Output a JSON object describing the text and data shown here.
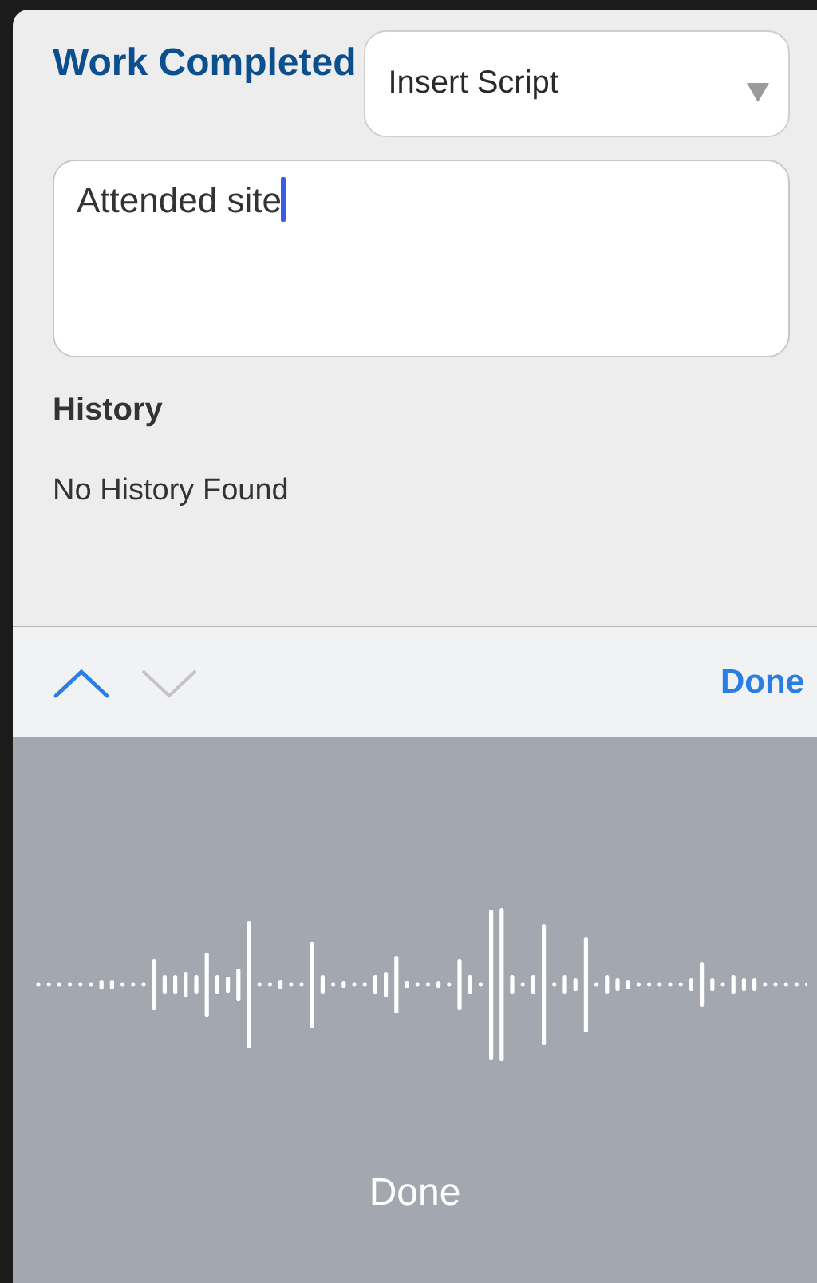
{
  "form": {
    "title": "Work Completed",
    "script_select": {
      "value": "Insert Script"
    },
    "notes": {
      "value": "Attended site"
    },
    "history": {
      "heading": "History",
      "empty_text": "No History Found"
    }
  },
  "keyboard_toolbar": {
    "previous": {
      "disabled": false
    },
    "next": {
      "disabled": true
    },
    "done": "Done"
  },
  "dictation": {
    "done": "Done"
  }
}
